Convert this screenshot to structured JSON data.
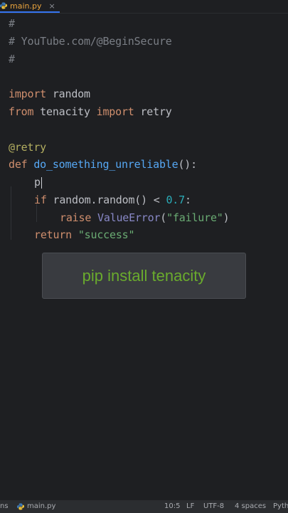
{
  "tab": {
    "filename": "main.py",
    "close": "×"
  },
  "code": {
    "l1": "#",
    "l2": "# YouTube.com/@BeginSecure",
    "l3": "#",
    "import_kw": "import",
    "import_mod": " random",
    "from_kw": "from",
    "from_mod": " tenacity ",
    "import_kw2": "import",
    "retry_name": " retry",
    "decorator": "@retry",
    "def_kw": "def",
    "fn_name": " do_something_unreliable",
    "fn_tail": "():",
    "typed": "p",
    "if_kw": "if",
    "if_expr": " random.random() < ",
    "if_num": "0.7",
    "if_colon": ":",
    "raise_kw": "raise",
    "raise_cls": " ValueError",
    "raise_open": "(",
    "raise_str": "\"failure\"",
    "raise_close": ")",
    "return_kw": "return",
    "return_str": " \"success\""
  },
  "overlay": {
    "text": "pip install tenacity"
  },
  "status": {
    "left": "ns",
    "file": "main.py",
    "position": "10:5",
    "line_ending": "LF",
    "encoding": "UTF-8",
    "indent": "4 spaces",
    "lang": "Pyth"
  }
}
